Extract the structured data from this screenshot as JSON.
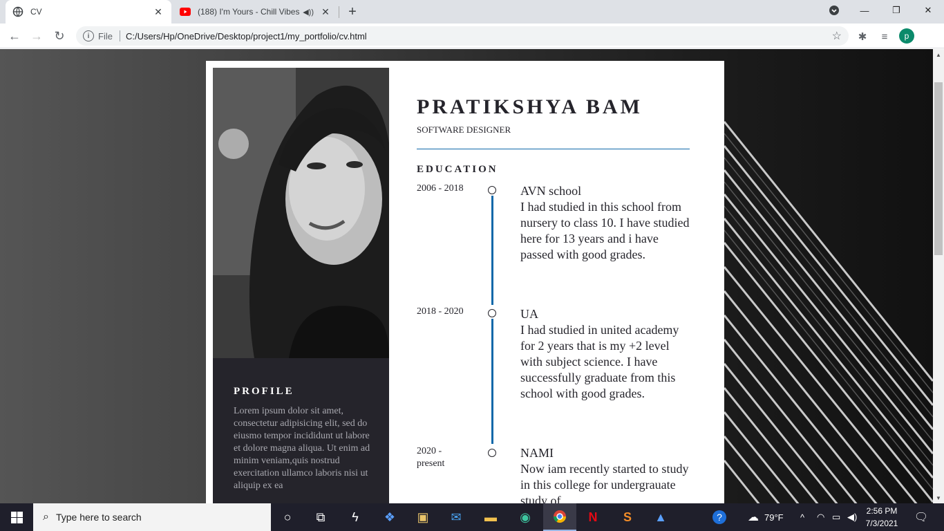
{
  "browser": {
    "tabs": [
      {
        "title": "CV",
        "active": true
      },
      {
        "title": "(188) I'm Yours - Chill Vibes",
        "active": false
      }
    ],
    "address": {
      "scheme": "File",
      "url": "C:/Users/Hp/OneDrive/Desktop/project1/my_portfolio/cv.html"
    },
    "profile_initial": "p",
    "colors": {
      "profile": "#0b8a6b",
      "youtube": "#ff0000"
    }
  },
  "cv": {
    "name": "PRATIKSHYA BAM",
    "role": "SOFTWARE DESIGNER",
    "profile": {
      "title": "PROFILE",
      "text": "Lorem ipsum dolor sit amet, consectetur adipisicing elit, sed do eiusmo tempor incididunt ut labore et dolore magna aliqua. Ut enim ad minim veniam,quis nostrud exercitation ullamco laboris nisi ut aliquip ex ea"
    },
    "education": {
      "title": "EDUCATION",
      "items": [
        {
          "years": "2006 - 2018",
          "school": "AVN school",
          "desc": "I had studied in this school from nursery to class 10. I have studied here for 13 years and i have passed with good grades."
        },
        {
          "years": "2018 - 2020",
          "school": "UA",
          "desc": "I had studied in united academy for 2 years that is my +2 level with subject science. I have successfully graduate from this school with good grades."
        },
        {
          "years": "2020 - present",
          "school": "NAMI",
          "desc": "Now iam recently started to study in this college for undergrauate study of"
        }
      ]
    },
    "accent_color": "#0e68a9",
    "sidebar_color": "#25242b"
  },
  "taskbar": {
    "search_placeholder": "Type here to search",
    "weather": "79°F",
    "time": "2:56 PM",
    "date": "7/3/2021"
  }
}
